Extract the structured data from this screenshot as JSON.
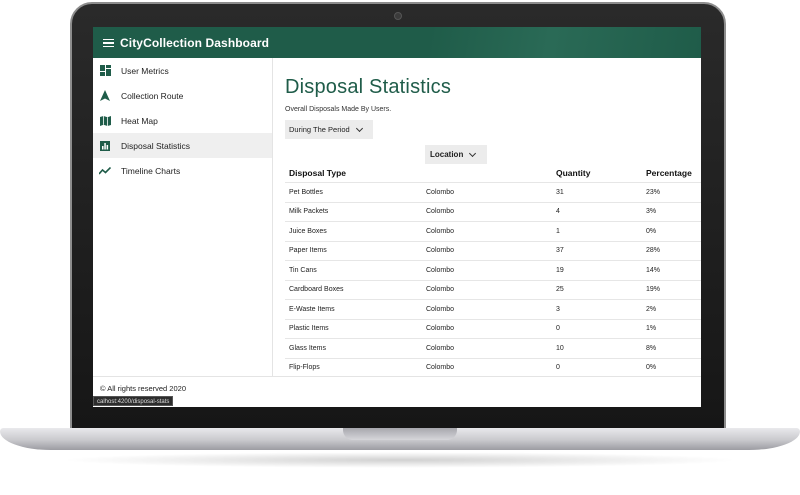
{
  "app": {
    "title": "CityCollection Dashboard"
  },
  "sidebar": {
    "items": [
      {
        "label": "User Metrics",
        "icon": "dashboard-icon"
      },
      {
        "label": "Collection Route",
        "icon": "navigation-arrow-icon"
      },
      {
        "label": "Heat Map",
        "icon": "map-icon"
      },
      {
        "label": "Disposal Statistics",
        "icon": "bar-chart-icon",
        "active": true
      },
      {
        "label": "Timeline Charts",
        "icon": "line-chart-icon"
      }
    ]
  },
  "main": {
    "title": "Disposal Statistics",
    "subtitle": "Overall Disposals Made By Users.",
    "period_select": "During The Period",
    "location_select": "Location",
    "table": {
      "headers": [
        "Disposal Type",
        "Quantity",
        "Percentage"
      ],
      "rows": [
        [
          "Pet Bottles",
          "Colombo",
          "31",
          "23%"
        ],
        [
          "Milk Packets",
          "Colombo",
          "4",
          "3%"
        ],
        [
          "Juice Boxes",
          "Colombo",
          "1",
          "0%"
        ],
        [
          "Paper Items",
          "Colombo",
          "37",
          "28%"
        ],
        [
          "Tin Cans",
          "Colombo",
          "19",
          "14%"
        ],
        [
          "Cardboard Boxes",
          "Colombo",
          "25",
          "19%"
        ],
        [
          "E-Waste Items",
          "Colombo",
          "3",
          "2%"
        ],
        [
          "Plastic Items",
          "Colombo",
          "0",
          "1%"
        ],
        [
          "Glass Items",
          "Colombo",
          "10",
          "8%"
        ],
        [
          "Flip-Flops",
          "Colombo",
          "0",
          "0%"
        ]
      ]
    }
  },
  "footer": {
    "copyright": "© All rights reserved 2020",
    "status_url": "calhost:4200/disposal-stats"
  },
  "colors": {
    "brand": "#1f5c49",
    "active_bg": "#efefef"
  }
}
